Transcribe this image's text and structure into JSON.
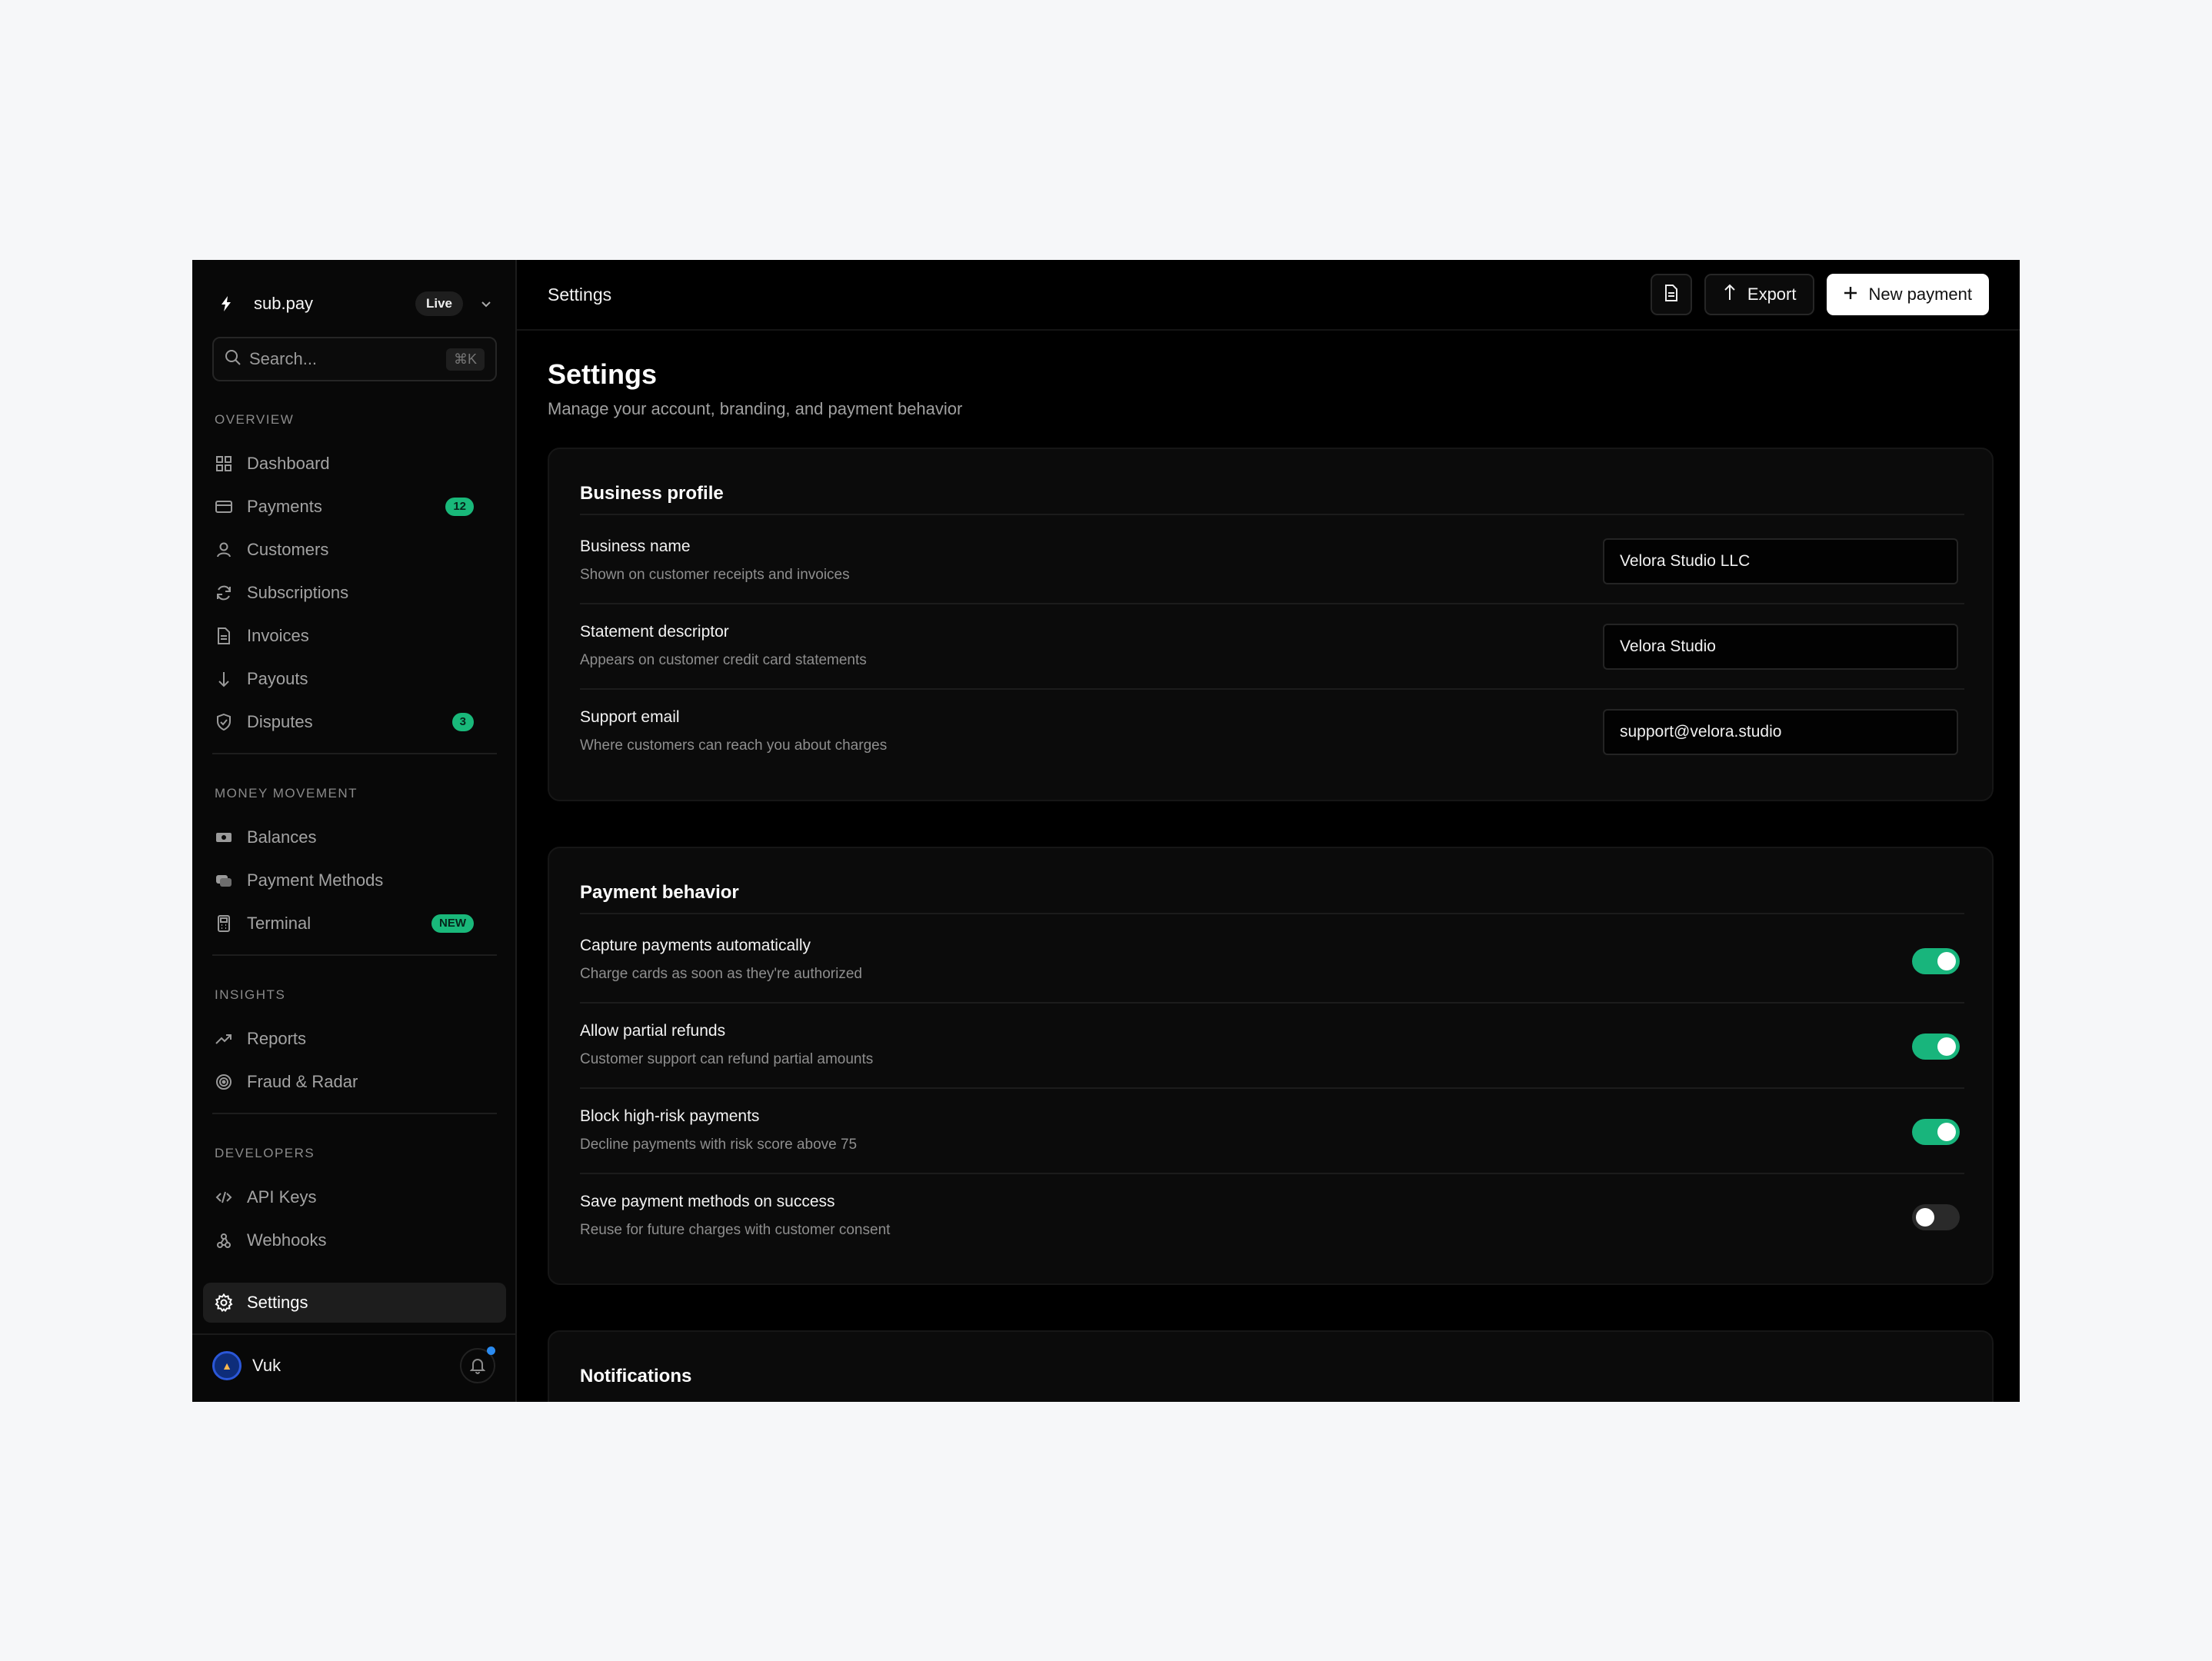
{
  "brand": {
    "name": "sub.pay",
    "mode_badge": "Live"
  },
  "search": {
    "placeholder": "Search...",
    "shortcut": "⌘K"
  },
  "sidebar": {
    "sections": [
      {
        "label": "OVERVIEW"
      },
      {
        "label": "MONEY MOVEMENT"
      },
      {
        "label": "INSIGHTS"
      },
      {
        "label": "DEVELOPERS"
      }
    ],
    "items": [
      {
        "label": "Dashboard",
        "icon": "grid-icon"
      },
      {
        "label": "Payments",
        "icon": "card-icon",
        "badge": "12"
      },
      {
        "label": "Customers",
        "icon": "user-icon"
      },
      {
        "label": "Subscriptions",
        "icon": "refresh-icon"
      },
      {
        "label": "Invoices",
        "icon": "document-icon"
      },
      {
        "label": "Payouts",
        "icon": "arrow-down-icon"
      },
      {
        "label": "Disputes",
        "icon": "shield-icon",
        "badge": "3"
      },
      {
        "label": "Balances",
        "icon": "cash-icon"
      },
      {
        "label": "Payment Methods",
        "icon": "cards-icon"
      },
      {
        "label": "Terminal",
        "icon": "terminal-icon",
        "badge": "NEW"
      },
      {
        "label": "Reports",
        "icon": "trending-up-icon"
      },
      {
        "label": "Fraud & Radar",
        "icon": "radar-icon"
      },
      {
        "label": "API Keys",
        "icon": "code-icon"
      },
      {
        "label": "Webhooks",
        "icon": "webhook-icon"
      },
      {
        "label": "Settings",
        "icon": "gear-icon",
        "active": true
      }
    ]
  },
  "user": {
    "name": "Vuk"
  },
  "topbar": {
    "breadcrumb": "Settings",
    "export_label": "Export",
    "new_payment_label": "New payment"
  },
  "page": {
    "title": "Settings",
    "subtitle": "Manage your account, branding, and payment behavior"
  },
  "business_profile": {
    "title": "Business profile",
    "rows": [
      {
        "title": "Business name",
        "desc": "Shown on customer receipts and invoices",
        "value": "Velora Studio LLC"
      },
      {
        "title": "Statement descriptor",
        "desc": "Appears on customer credit card statements",
        "value": "Velora Studio"
      },
      {
        "title": "Support email",
        "desc": "Where customers can reach you about charges",
        "value": "support@velora.studio"
      }
    ]
  },
  "payment_behavior": {
    "title": "Payment behavior",
    "rows": [
      {
        "title": "Capture payments automatically",
        "desc": "Charge cards as soon as they're authorized",
        "enabled": true
      },
      {
        "title": "Allow partial refunds",
        "desc": "Customer support can refund partial amounts",
        "enabled": true
      },
      {
        "title": "Block high-risk payments",
        "desc": "Decline payments with risk score above 75",
        "enabled": true
      },
      {
        "title": "Save payment methods on success",
        "desc": "Reuse for future charges with customer consent",
        "enabled": false
      }
    ]
  },
  "notifications": {
    "title": "Notifications"
  },
  "colors": {
    "accent": "#18b57c",
    "background": "#000000",
    "sidebar": "#080808"
  }
}
